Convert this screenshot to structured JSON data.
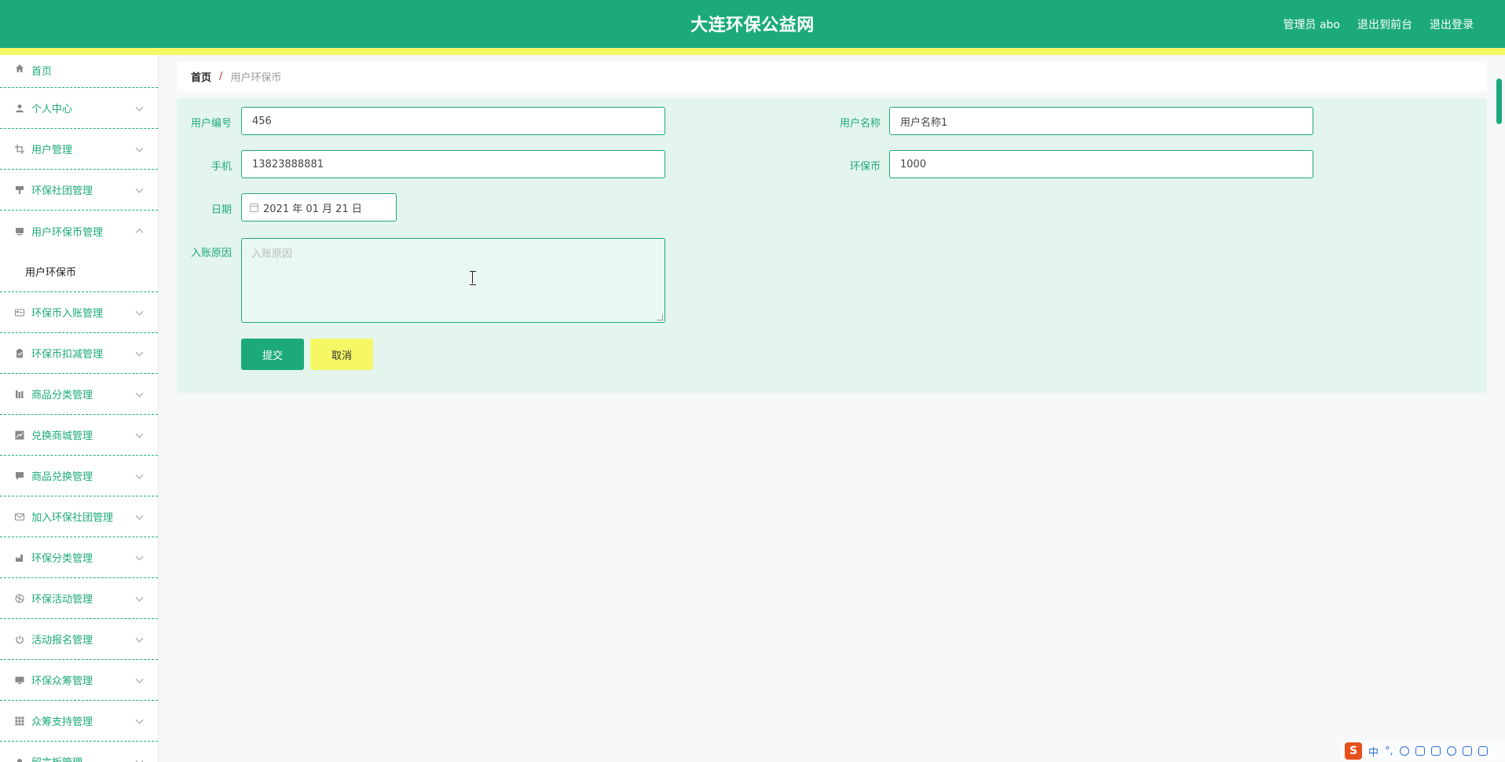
{
  "header": {
    "site_title": "大连环保公益网",
    "user": "管理员 abo",
    "back_to_front": "退出到前台",
    "logout": "退出登录"
  },
  "sidebar": {
    "items": [
      {
        "label": "首页",
        "icon": "home-icon"
      },
      {
        "label": "个人中心",
        "icon": "user-icon"
      },
      {
        "label": "用户管理",
        "icon": "crop-icon"
      },
      {
        "label": "环保社团管理",
        "icon": "brush-icon"
      },
      {
        "label": "用户环保币管理",
        "icon": "screen-icon"
      },
      {
        "label": "环保币入账管理",
        "icon": "card-icon"
      },
      {
        "label": "环保币扣减管理",
        "icon": "clipboard-icon"
      },
      {
        "label": "商品分类管理",
        "icon": "books-icon"
      },
      {
        "label": "兑换商城管理",
        "icon": "chart-icon"
      },
      {
        "label": "商品兑换管理",
        "icon": "message-icon"
      },
      {
        "label": "加入环保社团管理",
        "icon": "mail-icon"
      },
      {
        "label": "环保分类管理",
        "icon": "factory-icon"
      },
      {
        "label": "环保活动管理",
        "icon": "aperture-icon"
      },
      {
        "label": "活动报名管理",
        "icon": "power-icon"
      },
      {
        "label": "环保众筹管理",
        "icon": "monitor-icon"
      },
      {
        "label": "众筹支持管理",
        "icon": "grid-icon"
      },
      {
        "label": "留言板管理",
        "icon": "pin-icon"
      }
    ],
    "submenu_label": "用户环保币"
  },
  "breadcrumb": {
    "home": "首页",
    "separator": "/",
    "current": "用户环保币"
  },
  "form": {
    "user_no_label": "用户编号",
    "user_no_value": "456",
    "user_name_label": "用户名称",
    "user_name_value": "用户名称1",
    "phone_label": "手机",
    "phone_value": "13823888881",
    "coin_label": "环保币",
    "coin_value": "1000",
    "date_label": "日期",
    "date_value": "2021 年 01 月 21 日",
    "reason_label": "入账原因",
    "reason_placeholder": "入账原因",
    "submit_label": "提交",
    "cancel_label": "取消"
  },
  "ime": {
    "logo": "S",
    "mode": "中",
    "punct": "°,"
  },
  "colors": {
    "primary": "#1caa7b",
    "accent_yellow": "#f6f765",
    "panel_bg": "#e4f5ee"
  }
}
